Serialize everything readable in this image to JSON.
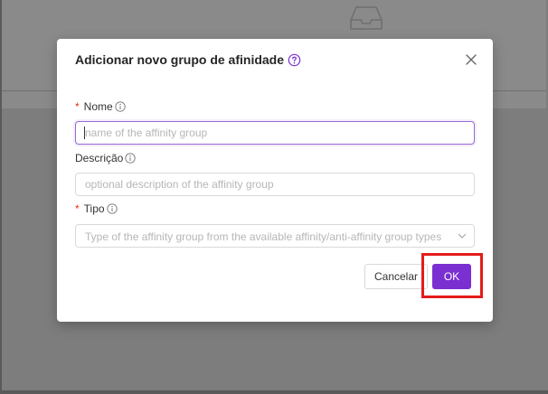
{
  "dialog": {
    "title": "Adicionar novo grupo de afinidade",
    "close_icon": "close-icon",
    "help_icon": "question-circle-icon"
  },
  "form": {
    "name": {
      "label": "Nome",
      "required": true,
      "value": "",
      "placeholder": "name of the affinity group"
    },
    "description": {
      "label": "Descrição",
      "required": false,
      "value": "",
      "placeholder": "optional description of the affinity group"
    },
    "type": {
      "label": "Tipo",
      "required": true,
      "selected": "",
      "placeholder": "Type of the affinity group from the available affinity/anti-affinity group types"
    },
    "required_marker": "*",
    "info_icon": "info-circle-icon"
  },
  "buttons": {
    "cancel_label": "Cancelar",
    "ok_label": "OK"
  },
  "colors": {
    "accent": "#7a2fd0",
    "focus_border": "#9a6ad6",
    "required_marker": "#e0301e",
    "highlight": "#e41b1b"
  }
}
